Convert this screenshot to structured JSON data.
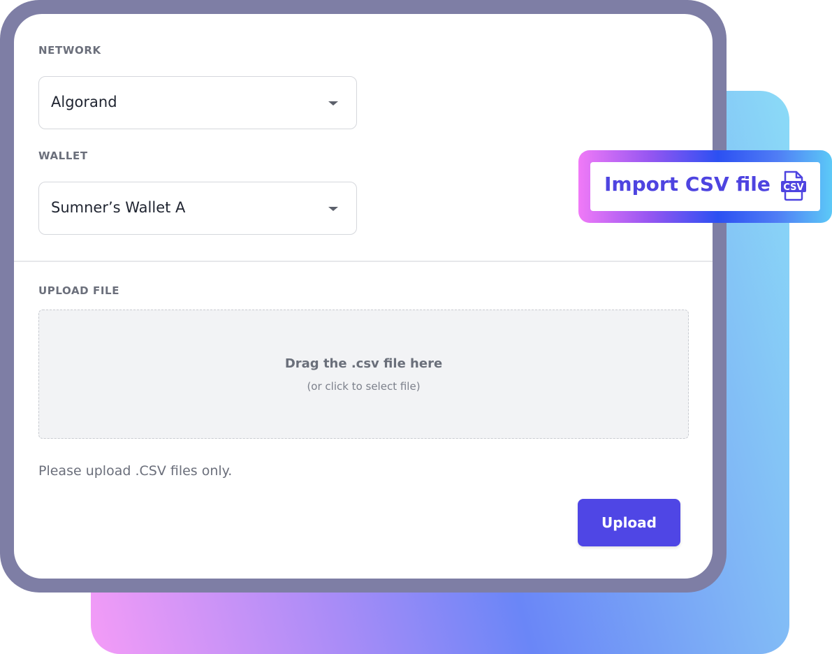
{
  "network": {
    "label": "NETWORK",
    "selected": "Algorand"
  },
  "wallet": {
    "label": "WALLET",
    "selected": "Sumner’s Wallet A"
  },
  "upload": {
    "label": "UPLOAD FILE",
    "dropzone_title": "Drag the .csv file here",
    "dropzone_subtitle": "(or click to select file)",
    "hint": "Please upload .CSV files only.",
    "button_label": "Upload"
  },
  "badge": {
    "label": "Import CSV file",
    "icon": "csv-file-icon",
    "icon_text": "CSV"
  },
  "colors": {
    "accent": "#4f46e5",
    "frame": "#7e7ea5",
    "badge_text": "#4e44e0"
  }
}
